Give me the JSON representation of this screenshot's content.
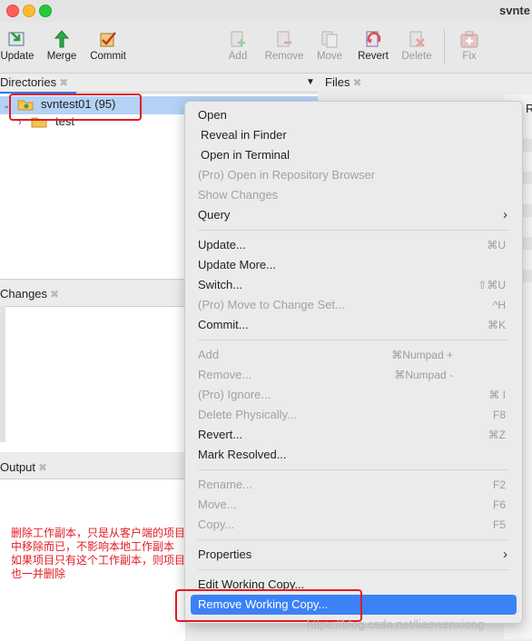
{
  "window": {
    "title": "svnte"
  },
  "toolbar": {
    "update": "Update",
    "merge": "Merge",
    "commit": "Commit",
    "add": "Add",
    "remove": "Remove",
    "move": "Move",
    "revert": "Revert",
    "delete": "Delete",
    "fix": "Fix"
  },
  "panels": {
    "directories": "Directories",
    "files": "Files",
    "files_col": "R",
    "changes": "Changes",
    "output": "Output"
  },
  "tree": [
    {
      "label": "svntest01 (95)"
    },
    {
      "label": "test"
    }
  ],
  "menu": {
    "open": "Open",
    "reveal": "Reveal in Finder",
    "open_terminal": "Open in Terminal",
    "open_repo": "(Pro) Open in Repository Browser",
    "show_changes": "Show Changes",
    "query": "Query",
    "update": "Update...",
    "update_sc": "⌘U",
    "update_more": "Update More...",
    "switch": "Switch...",
    "switch_sc": "⇧⌘U",
    "move_changeset": "(Pro) Move to Change Set...",
    "move_changeset_sc": "^H",
    "commit": "Commit...",
    "commit_sc": "⌘K",
    "add": "Add",
    "add_sc": "⌘Numpad +",
    "remove": "Remove...",
    "remove_sc": "⌘Numpad -",
    "ignore": "(Pro) Ignore...",
    "ignore_sc": "⌘ I",
    "delete_phys": "Delete Physically...",
    "delete_phys_sc": "F8",
    "revert": "Revert...",
    "revert_sc": "⌘Z",
    "mark_resolved": "Mark Resolved...",
    "rename": "Rename...",
    "rename_sc": "F2",
    "move": "Move...",
    "move_sc": "F6",
    "copy": "Copy...",
    "copy_sc": "F5",
    "properties": "Properties",
    "edit_wc": "Edit Working Copy...",
    "remove_wc": "Remove Working Copy..."
  },
  "annotation": "删除工作副本，只是从客户端的项目中移除而已，不影响本地工作副本如果项目只有这个工作副本，则项目也一并删除",
  "annotation_lines": [
    "删除工作副本，只是从客户端的项目",
    "中移除而已，不影响本地工作副本",
    "如果项目只有这个工作副本，则项目",
    "也一并删除"
  ],
  "watermark": "https://blog.csdn.net/liaowenxiong",
  "colors": {
    "accent": "#3b82f6",
    "annotation_red": "#e31b23",
    "selection": "#b4d2f5"
  }
}
